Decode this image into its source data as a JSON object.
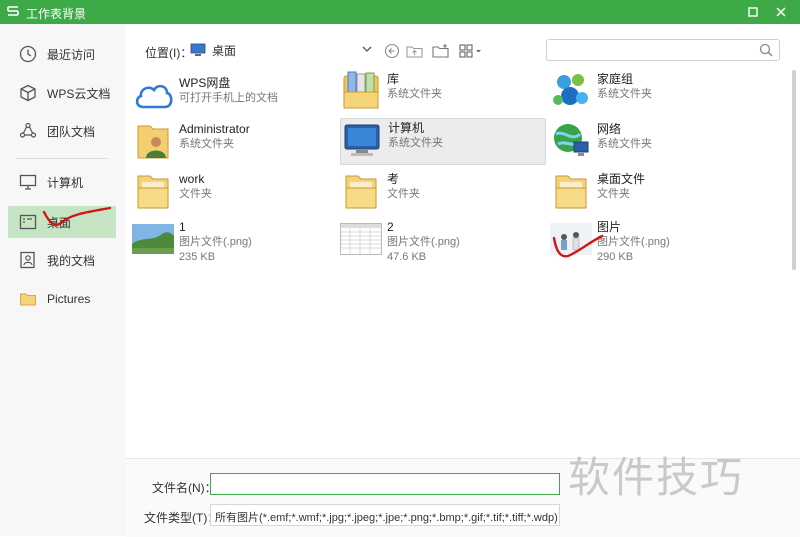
{
  "window": {
    "title": "工作表背景",
    "accent": "#3daa47"
  },
  "sidebar": {
    "items": [
      {
        "label": "最近访问",
        "icon": "clock-icon"
      },
      {
        "label": "WPS云文档",
        "icon": "cube-icon"
      },
      {
        "label": "团队文档",
        "icon": "team-icon"
      },
      {
        "label": "计算机",
        "icon": "monitor-icon"
      },
      {
        "label": "桌面",
        "icon": "desktop-icon",
        "active": true
      },
      {
        "label": "我的文档",
        "icon": "documents-icon"
      },
      {
        "label": "Pictures",
        "icon": "folder-icon"
      }
    ]
  },
  "toolbar": {
    "location_label": "位置(I)：",
    "location_value": "桌面",
    "search_placeholder": ""
  },
  "files": [
    {
      "name": "WPS网盘",
      "type": "可打开手机上的文档",
      "size": "",
      "icon": "cloud-icon"
    },
    {
      "name": "库",
      "type": "系统文件夹",
      "size": "",
      "icon": "library-icon"
    },
    {
      "name": "家庭组",
      "type": "系统文件夹",
      "size": "",
      "icon": "homegroup-icon"
    },
    {
      "name": "Administrator",
      "type": "系统文件夹",
      "size": "",
      "icon": "user-folder-icon"
    },
    {
      "name": "计算机",
      "type": "系统文件夹",
      "size": "",
      "icon": "computer-icon",
      "selected": true
    },
    {
      "name": "网络",
      "type": "系统文件夹",
      "size": "",
      "icon": "network-icon"
    },
    {
      "name": "work",
      "type": "文件夹",
      "size": "",
      "icon": "folder-icon"
    },
    {
      "name": "考",
      "type": "文件夹",
      "size": "",
      "icon": "folder-icon"
    },
    {
      "name": "桌面文件",
      "type": "文件夹",
      "size": "",
      "icon": "folder-icon"
    },
    {
      "name": "1",
      "type": "图片文件(.png)",
      "size": "235 KB",
      "icon": "image-thumbnail-icon"
    },
    {
      "name": "2",
      "type": "图片文件(.png)",
      "size": "47.6 KB",
      "icon": "spreadsheet-thumbnail-icon"
    },
    {
      "name": "图片",
      "type": "图片文件(.png)",
      "size": "290 KB",
      "icon": "photo-thumbnail-icon"
    }
  ],
  "bottom": {
    "filename_label": "文件名(N)：",
    "filename_value": "",
    "filetype_label": "文件类型(T)：",
    "filetype_value": "所有图片(*.emf;*.wmf;*.jpg;*.jpeg;*.jpe;*.png;*.bmp;*.gif;*.tif;*.tiff;*.wdp)"
  },
  "watermark": "软件技巧"
}
